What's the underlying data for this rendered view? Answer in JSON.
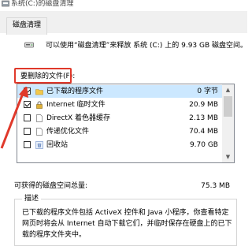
{
  "window": {
    "title": "系统(C:)的磁盘清理"
  },
  "tabs": [
    {
      "label": "磁盘清理"
    }
  ],
  "header": {
    "text": "可以使用“磁盘清理”来释放 系统 (C:) 上的 9.93 GB 磁盘空间。"
  },
  "files_to_delete": {
    "label": "要删除的文件(F):",
    "items": [
      {
        "label": "已下载的程序文件",
        "size": "0 字节",
        "checked": true,
        "icon": "folder-icon"
      },
      {
        "label": "Internet 临时文件",
        "size": "20.9 MB",
        "checked": true,
        "icon": "lock-icon"
      },
      {
        "label": "DirectX 着色器缓存",
        "size": "2.13 MB",
        "checked": false,
        "icon": "document-icon"
      },
      {
        "label": "传递优化文件",
        "size": "70.4 MB",
        "checked": false,
        "icon": "document-icon"
      },
      {
        "label": "回收站",
        "size": "9.70 GB",
        "checked": false,
        "icon": "recycle-bin-icon"
      }
    ]
  },
  "total": {
    "label": "可获得的磁盘空间总量:",
    "value": "75.3 MB"
  },
  "description": {
    "label": "描述",
    "text": "已下载的程序文件包括 ActiveX 控件和 Java 小程序，你查看特定网页时将会从 Internet 自动下载它们，并临时保存在硬盘上的已下载的程序文件夹中。"
  },
  "colors": {
    "annotation": "#e0392b",
    "selection": "#cce8ff"
  }
}
